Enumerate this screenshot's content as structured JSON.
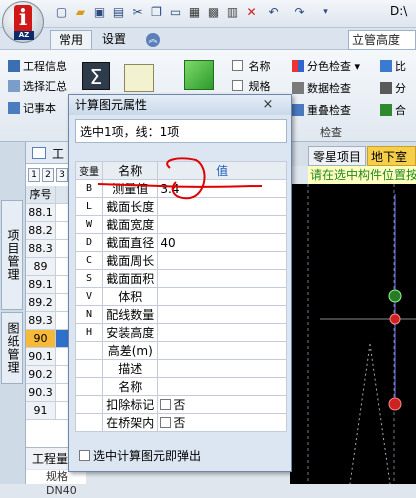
{
  "window": {
    "path_fragment": "D:\\"
  },
  "quick_access": [
    "new-icon",
    "open-icon",
    "save-icon",
    "saveas-icon",
    "cut-icon",
    "copy-icon",
    "paste-icon",
    "delete-icon",
    "undo-icon",
    "redo-icon",
    "dropdown-icon"
  ],
  "tabs": {
    "common": "常用",
    "settings": "设置"
  },
  "search": {
    "value": "立管高度"
  },
  "ribbon": {
    "col1": [
      "工程信息",
      "选择汇总",
      "记事本"
    ],
    "col3": [
      "名称",
      "规格"
    ],
    "col4": [
      "分色检查",
      "数据检查",
      "重叠检查"
    ],
    "col4_group": "检查",
    "col5": [
      "比",
      "分",
      "合"
    ]
  },
  "left_tabs": {
    "project": "项目管理",
    "drawing": "图纸管理"
  },
  "grid": {
    "header_fragment": "工",
    "tabs": [
      "1",
      "2",
      "3"
    ],
    "seq_header": "序号",
    "rows": [
      "88.1",
      "88.2",
      "88.3",
      "89",
      "89.1",
      "89.2",
      "89.3",
      "90",
      "90.1",
      "90.2",
      "90.3",
      "91"
    ],
    "selected_row": "90"
  },
  "bottom": {
    "label": "工程量",
    "prop": "规格 DN40"
  },
  "right": {
    "parts_tab": "零星项目",
    "basement_tab": "地下室暗",
    "hint": "请在选中构件位置按"
  },
  "dialog": {
    "title": "计算图元属性",
    "close": "×",
    "summary": "选中1项，线：1项",
    "headers": {
      "var": "变量",
      "name": "名称",
      "value": "值"
    },
    "rows": [
      {
        "var": "B",
        "name": "测量值",
        "value": "3.4"
      },
      {
        "var": "L",
        "name": "截面长度",
        "value": ""
      },
      {
        "var": "W",
        "name": "截面宽度",
        "value": ""
      },
      {
        "var": "D",
        "name": "截面直径",
        "value": "40"
      },
      {
        "var": "C",
        "name": "截面周长",
        "value": ""
      },
      {
        "var": "S",
        "name": "截面面积",
        "value": ""
      },
      {
        "var": "V",
        "name": "体积",
        "value": ""
      },
      {
        "var": "N",
        "name": "配线数量",
        "value": ""
      },
      {
        "var": "H",
        "name": "安装高度",
        "value": ""
      },
      {
        "var": "",
        "name": "高差(m)",
        "value": ""
      },
      {
        "var": "",
        "name": "描述",
        "value": ""
      },
      {
        "var": "",
        "name": "名称",
        "value": ""
      },
      {
        "var": "",
        "name": "扣除标记",
        "value": "否"
      },
      {
        "var": "",
        "name": "在桥架内",
        "value": "否"
      }
    ],
    "footer": "选中计算图元即弹出"
  },
  "colors": {
    "accent": "#2f70c8",
    "selected_row": "#f6b93a",
    "hint_bg": "#ffffc0",
    "annotation": "#e00000",
    "canvas": "#000000"
  }
}
